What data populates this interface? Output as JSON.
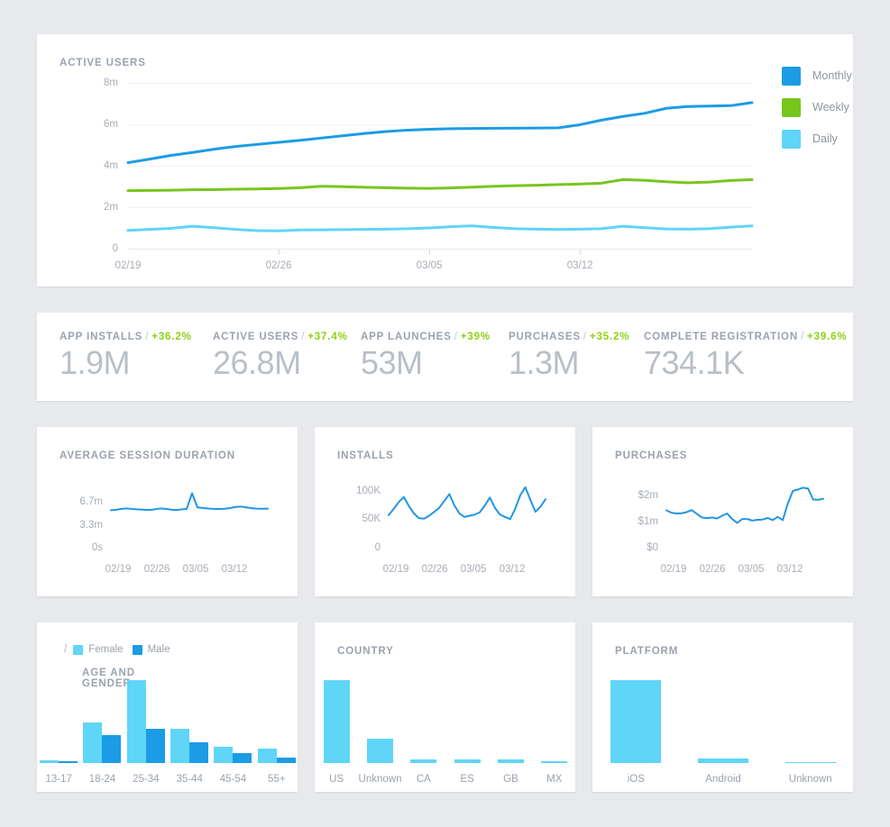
{
  "theme": {
    "page_bg": "#e7e9ec",
    "card_bg": "#ffffff",
    "title_color": "#9aa2ae",
    "accent_green": "#8cd211",
    "monthly_blue": "#1b9ce5",
    "weekly_green": "#76c61e",
    "daily_cyan": "#5fd5f7",
    "value_gray": "#b9bfc7"
  },
  "active_users": {
    "title": "ACTIVE USERS",
    "legend": [
      {
        "label": "Monthly",
        "color": "#1b9ce5"
      },
      {
        "label": "Weekly",
        "color": "#76c61e"
      },
      {
        "label": "Daily",
        "color": "#5fd5f7"
      }
    ]
  },
  "kpis": [
    {
      "name": "APP INSTALLS",
      "slash": "/",
      "delta": "+36.2%",
      "value": "1.9M"
    },
    {
      "name": "ACTIVE USERS",
      "slash": "/",
      "delta": "+37.4%",
      "value": "26.8M"
    },
    {
      "name": "APP LAUNCHES",
      "slash": "/",
      "delta": "+39%",
      "value": "53M"
    },
    {
      "name": "PURCHASES",
      "slash": "/",
      "delta": "+35.2%",
      "value": "1.3M"
    },
    {
      "name": "COMPLETE REGISTRATION",
      "slash": "/",
      "delta": "+39.6%",
      "value": "734.1K"
    }
  ],
  "small_charts": {
    "session": {
      "title": "AVERAGE SESSION DURATION"
    },
    "installs": {
      "title": "INSTALLS"
    },
    "purchases": {
      "title": "PURCHASES"
    }
  },
  "bar_charts": {
    "age_gender": {
      "title": "AGE AND GENDER",
      "separator": "/",
      "legend": [
        {
          "label": "Female",
          "color": "#5fd5f7"
        },
        {
          "label": "Male",
          "color": "#1b9ce5"
        }
      ]
    },
    "country": {
      "title": "COUNTRY"
    },
    "platform": {
      "title": "PLATFORM"
    }
  },
  "chart_data": [
    {
      "id": "active-users",
      "type": "line",
      "title": "ACTIVE USERS",
      "xlabel": "",
      "ylabel": "",
      "ylim": [
        0,
        8000000
      ],
      "ytick_labels": [
        "0",
        "2m",
        "4m",
        "6m",
        "8m"
      ],
      "ytick_values": [
        0,
        2000000,
        4000000,
        6000000,
        8000000
      ],
      "xtick_labels": [
        "02/19",
        "02/26",
        "03/05",
        "03/12"
      ],
      "xtick_indices": [
        0,
        7,
        14,
        21
      ],
      "grid": true,
      "legend_position": "right",
      "n_points": 28,
      "series": [
        {
          "name": "Monthly",
          "color": "#1b9ce5",
          "values": [
            4150000,
            4320000,
            4500000,
            4640000,
            4800000,
            4930000,
            5030000,
            5130000,
            5230000,
            5340000,
            5450000,
            5560000,
            5650000,
            5720000,
            5760000,
            5790000,
            5800000,
            5810000,
            5815000,
            5820000,
            5830000,
            5980000,
            6200000,
            6380000,
            6530000,
            6770000,
            6860000,
            6880000,
            6900000,
            7050000
          ]
        },
        {
          "name": "Weekly",
          "color": "#76c61e",
          "values": [
            2800000,
            2810000,
            2820000,
            2840000,
            2850000,
            2870000,
            2880000,
            2900000,
            2940000,
            3010000,
            2990000,
            2960000,
            2940000,
            2920000,
            2910000,
            2930000,
            2970000,
            3010000,
            3040000,
            3060000,
            3090000,
            3120000,
            3160000,
            3330000,
            3300000,
            3230000,
            3180000,
            3210000,
            3290000,
            3330000
          ]
        },
        {
          "name": "Daily",
          "color": "#5fd5f7",
          "values": [
            880000,
            930000,
            980000,
            1080000,
            1010000,
            930000,
            870000,
            860000,
            900000,
            910000,
            920000,
            930000,
            940000,
            960000,
            1000000,
            1060000,
            1100000,
            1020000,
            960000,
            940000,
            930000,
            940000,
            960000,
            1080000,
            1010000,
            950000,
            940000,
            960000,
            1040000,
            1100000
          ]
        }
      ]
    },
    {
      "id": "average-session-duration",
      "type": "line",
      "title": "AVERAGE SESSION DURATION",
      "ylim": [
        0,
        10050
      ],
      "ytick_labels": [
        "0s",
        "3.3m",
        "6.7m"
      ],
      "ytick_values": [
        0,
        3300,
        6700
      ],
      "xtick_labels": [
        "02/19",
        "02/26",
        "03/05",
        "03/12"
      ],
      "color": "#2196e3",
      "values": [
        5500,
        5570,
        5720,
        5760,
        5680,
        5620,
        5580,
        5540,
        5620,
        5760,
        5720,
        5600,
        5520,
        5620,
        5700,
        8000,
        5920,
        5830,
        5750,
        5700,
        5680,
        5720,
        5820,
        5980,
        6040,
        5930,
        5800,
        5740,
        5720,
        5730
      ]
    },
    {
      "id": "installs",
      "type": "line",
      "title": "INSTALLS",
      "ylim": [
        0,
        120000
      ],
      "ytick_labels": [
        "0",
        "50K",
        "100K"
      ],
      "ytick_values": [
        0,
        50000,
        100000
      ],
      "xtick_labels": [
        "02/19",
        "02/26",
        "03/05",
        "03/12"
      ],
      "color": "#2196e3",
      "values": [
        57000,
        68000,
        80000,
        89000,
        73000,
        60000,
        52000,
        51000,
        56000,
        63000,
        70000,
        82000,
        94000,
        74000,
        60000,
        54000,
        56000,
        58000,
        62000,
        74000,
        88000,
        70000,
        58000,
        54000,
        50000,
        68000,
        92000,
        106000,
        84000,
        63000,
        72000,
        85000
      ]
    },
    {
      "id": "purchases-trend",
      "type": "line",
      "title": "PURCHASES",
      "ylim": [
        0,
        2600000
      ],
      "ytick_labels": [
        "$0",
        "$1m",
        "$2m"
      ],
      "ytick_values": [
        0,
        1000000,
        2000000
      ],
      "xtick_labels": [
        "02/19",
        "02/26",
        "03/05",
        "03/12"
      ],
      "color": "#2196e3",
      "values": [
        1420000,
        1330000,
        1300000,
        1310000,
        1350000,
        1430000,
        1290000,
        1150000,
        1120000,
        1150000,
        1110000,
        1210000,
        1300000,
        1090000,
        940000,
        1090000,
        1090000,
        1030000,
        1060000,
        1070000,
        1130000,
        1050000,
        1170000,
        1050000,
        1680000,
        2160000,
        2210000,
        2280000,
        2250000,
        1830000,
        1820000,
        1860000
      ]
    },
    {
      "id": "age-and-gender",
      "type": "bar",
      "title": "AGE AND GENDER",
      "categories": [
        "13-17",
        "18-24",
        "25-34",
        "35-44",
        "45-54",
        "55+"
      ],
      "ylim": [
        0,
        100
      ],
      "series": [
        {
          "name": "Female",
          "color": "#5fd5f7",
          "values": [
            3,
            49,
            100,
            41,
            20,
            17
          ]
        },
        {
          "name": "Male",
          "color": "#1b9ce5",
          "values": [
            2,
            34,
            41,
            25,
            12,
            7
          ]
        }
      ]
    },
    {
      "id": "country",
      "type": "bar",
      "title": "COUNTRY",
      "categories": [
        "US",
        "Unknown",
        "CA",
        "ES",
        "GB",
        "MX"
      ],
      "ylim": [
        0,
        100
      ],
      "color": "#5fd5f7",
      "values": [
        100,
        29,
        4,
        4,
        4,
        2
      ]
    },
    {
      "id": "platform",
      "type": "bar",
      "title": "PLATFORM",
      "categories": [
        "iOS",
        "Android",
        "Unknown"
      ],
      "ylim": [
        0,
        100
      ],
      "color": "#5fd5f7",
      "values": [
        100,
        5,
        0
      ]
    }
  ]
}
